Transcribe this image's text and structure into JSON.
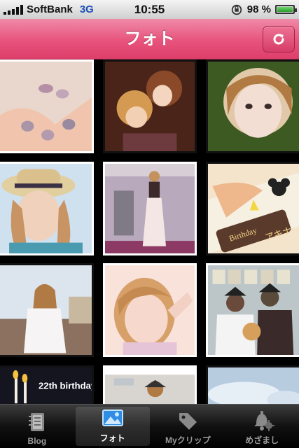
{
  "status_bar": {
    "carrier": "SoftBank",
    "network": "3G",
    "time": "10:55",
    "battery": "98 %",
    "battery_level": 0.98
  },
  "nav": {
    "title": "フォト",
    "refresh_icon": "refresh-icon"
  },
  "tabs": [
    {
      "label": "Blog",
      "icon": "notebook-icon",
      "active": false
    },
    {
      "label": "フォト",
      "icon": "photo-icon",
      "active": true
    },
    {
      "label": "Myクリップ",
      "icon": "tag-icon",
      "active": false
    },
    {
      "label": "めざまし",
      "icon": "alarm-bell-icon",
      "active": false
    }
  ],
  "photos": {
    "caption_birthday": "22th birthday",
    "caption_cake": "Birthday",
    "caption_cake_name": "アキナ"
  },
  "colors": {
    "nav_pink": "#e7537c",
    "tab_bar": "#111111",
    "active_tab_label": "#ffffff"
  }
}
